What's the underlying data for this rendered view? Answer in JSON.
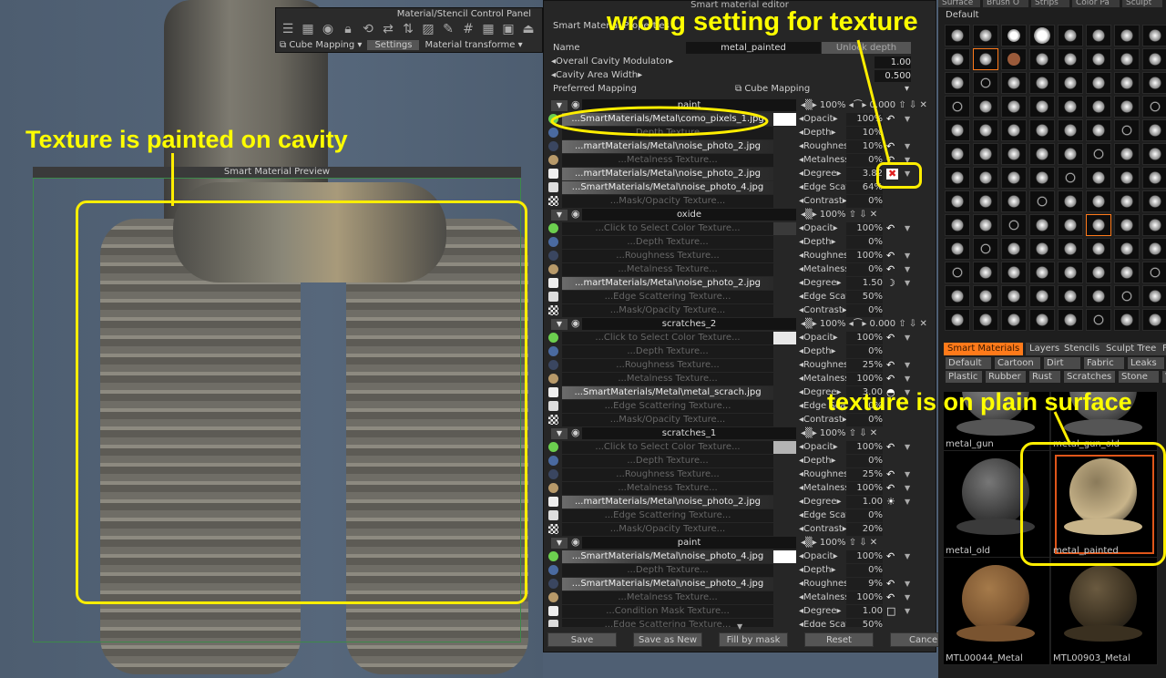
{
  "control_panel": {
    "title": "Material/Stencil  Control  Panel",
    "icons": [
      "sliders-icon",
      "grid-icon",
      "eye-icon",
      "lock-icon",
      "rotate-icon",
      "swap-horizontal-icon",
      "swap-vertical-icon",
      "hatch-icon",
      "pencil-icon",
      "grid-hash-icon",
      "grid-icon",
      "save-icon",
      "load-icon"
    ],
    "mapping": "Cube  Mapping",
    "settings": "Settings",
    "transform": "Material  transforme"
  },
  "preview": {
    "title": "Smart  Material  Preview"
  },
  "editor": {
    "title": "Smart  material  editor",
    "section": "Smart  Material  Properties",
    "name_label": "Name",
    "name_value": "metal_painted",
    "unlock": "Unlock  depth",
    "cavity_label": "Overall  Cavity  Modulator",
    "cavity_value": "1.00",
    "width_label": "Cavity  Area  Width",
    "width_value": "0.500",
    "mapping_label": "Preferred  Mapping",
    "mapping_value": "Cube  Mapping",
    "layers": [
      {
        "name": "paint",
        "pct": "100%",
        "extra": "0.000",
        "rows": [
          {
            "t": "...SmartMaterials/Metal\\como_pixels_1.jpg",
            "f": true,
            "sw": "#ffffff",
            "p": "Opacit",
            "v": "100%",
            "ti": "↶"
          },
          {
            "t": "...Depth  Texture...",
            "p": "Depth",
            "v": "10%"
          },
          {
            "t": "...martMaterials/Metal\\noise_photo_2.jpg",
            "f": true,
            "p": "Roughness",
            "v": "10%",
            "ti": "↶"
          },
          {
            "t": "...Metalness  Texture...",
            "p": "Metalness",
            "v": "0%",
            "ti": "↶"
          },
          {
            "t": "...martMaterials/Metal\\noise_photo_2.jpg",
            "f": true,
            "p": "Degree",
            "v": "3.82",
            "ti": "✖"
          },
          {
            "t": "...SmartMaterials/Metal\\noise_photo_4.jpg",
            "f": true,
            "p": "Edge  Scatte",
            "v": "64%"
          },
          {
            "t": "...Mask/Opacity  Texture...",
            "p": "Contrast",
            "v": "0%"
          }
        ]
      },
      {
        "name": "oxide",
        "pct": "100%",
        "extra": "",
        "rows": [
          {
            "t": "...Click  to  Select  Color  Texture...",
            "sw": "#3a3a3a",
            "p": "Opacit",
            "v": "100%",
            "ti": "↶"
          },
          {
            "t": "...Depth  Texture...",
            "p": "Depth",
            "v": "0%"
          },
          {
            "t": "...Roughness  Texture...",
            "p": "Roughness",
            "v": "100%",
            "ti": "↶"
          },
          {
            "t": "...Metalness  Texture...",
            "p": "Metalness",
            "v": "0%",
            "ti": "↶"
          },
          {
            "t": "...martMaterials/Metal\\noise_photo_2.jpg",
            "f": true,
            "p": "Degree",
            "v": "1.50",
            "ti": "☽"
          },
          {
            "t": "...Edge  Scattering  Texture...",
            "p": "Edge  Scatte",
            "v": "50%"
          },
          {
            "t": "...Mask/Opacity  Texture...",
            "p": "Contrast",
            "v": "0%"
          }
        ]
      },
      {
        "name": "scratches_2",
        "pct": "100%",
        "extra": "0.000",
        "rows": [
          {
            "t": "...Click  to  Select  Color  Texture...",
            "sw": "#e8e8e8",
            "p": "Opacit",
            "v": "100%",
            "ti": "↶"
          },
          {
            "t": "...Depth  Texture...",
            "p": "Depth",
            "v": "0%"
          },
          {
            "t": "...Roughness  Texture...",
            "p": "Roughness",
            "v": "25%",
            "ti": "↶"
          },
          {
            "t": "...Metalness  Texture...",
            "p": "Metalness",
            "v": "100%",
            "ti": "↶"
          },
          {
            "t": "...SmartMaterials/Metal\\metal_scrach.jpg",
            "f": true,
            "p": "Degree",
            "v": "3.00",
            "ti": "◓"
          },
          {
            "t": "...Edge  Scattering  Texture...",
            "p": "Edge  Scatte",
            "v": "0%"
          },
          {
            "t": "...Mask/Opacity  Texture...",
            "p": "Contrast",
            "v": "0%"
          }
        ]
      },
      {
        "name": "scratches_1",
        "pct": "100%",
        "extra": "",
        "rows": [
          {
            "t": "...Click  to  Select  Color  Texture...",
            "sw": "#b4b4b4",
            "p": "Opacit",
            "v": "100%",
            "ti": "↶"
          },
          {
            "t": "...Depth  Texture...",
            "p": "Depth",
            "v": "0%"
          },
          {
            "t": "...Roughness  Texture...",
            "p": "Roughness",
            "v": "25%",
            "ti": "↶"
          },
          {
            "t": "...Metalness  Texture...",
            "p": "Metalness",
            "v": "100%",
            "ti": "↶"
          },
          {
            "t": "...martMaterials/Metal\\noise_photo_2.jpg",
            "f": true,
            "p": "Degree",
            "v": "1.00",
            "ti": "☀"
          },
          {
            "t": "...Edge  Scattering  Texture...",
            "p": "Edge  Scatte",
            "v": "0%"
          },
          {
            "t": "...Mask/Opacity  Texture...",
            "p": "Contrast",
            "v": "20%"
          }
        ]
      },
      {
        "name": "paint",
        "pct": "100%",
        "extra": "",
        "rows": [
          {
            "t": "...SmartMaterials/Metal\\noise_photo_4.jpg",
            "f": true,
            "sw": "#ffffff",
            "p": "Opacit",
            "v": "100%",
            "ti": "↶"
          },
          {
            "t": "...Depth  Texture...",
            "p": "Depth",
            "v": "0%"
          },
          {
            "t": "...SmartMaterials/Metal\\noise_photo_4.jpg",
            "f": true,
            "p": "Roughness",
            "v": "9%",
            "ti": "↶"
          },
          {
            "t": "...Metalness  Texture...",
            "p": "Metalness",
            "v": "100%",
            "ti": "↶"
          },
          {
            "t": "...Condition  Mask  Texture...",
            "p": "Degree",
            "v": "1.00",
            "ti": "□"
          },
          {
            "t": "...Edge  Scattering  Texture...",
            "p": "Edge  Scatte",
            "v": "50%"
          }
        ]
      }
    ],
    "buttons": [
      "Save",
      "Save  as  New",
      "Fill  by  mask",
      "Reset",
      "Cancel"
    ]
  },
  "right_panel": {
    "top_tabs": [
      "Surface",
      "Brush  O",
      "Strips",
      "Color  Pa",
      "Sculpt"
    ],
    "brush_set": "Default",
    "tabs": [
      "Smart  Materials",
      "Layers",
      "Stencils",
      "Sculpt  Tree",
      "F"
    ],
    "categories_row1": [
      "Default",
      "Cartoon",
      "Dirt",
      "Fabric",
      "Leaks",
      "Leat"
    ],
    "categories_row2": [
      "Plastic",
      "Rubber",
      "Rust",
      "Scratches",
      "Stone",
      "W"
    ],
    "materials": [
      "metal_gun",
      "metal_gun_old",
      "metal_old",
      "metal_painted",
      "MTL00044_Metal",
      "MTL00903_Metal"
    ]
  },
  "annotations": {
    "cavity": "Texture is painted on cavity",
    "wrong": "wrong setting for texture",
    "plain": "texture is on plain surface"
  },
  "colors": {
    "annotation": "#ffff00",
    "accent": "#ff7a1a",
    "color_icon": "#6ccf4f"
  }
}
